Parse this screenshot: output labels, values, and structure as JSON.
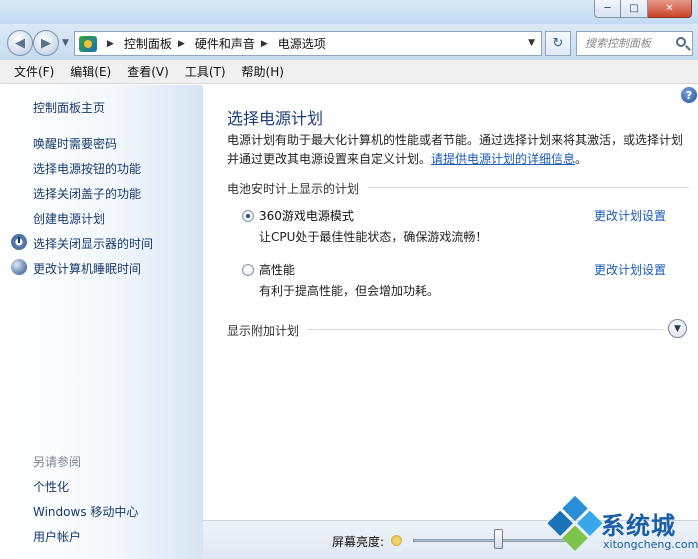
{
  "window": {
    "title": "",
    "minimize_glyph": "─",
    "maximize_glyph": "□",
    "close_glyph": "✕"
  },
  "navigation": {
    "back_glyph": "◀",
    "forward_glyph": "▶",
    "breadcrumbs": [
      "控制面板",
      "硬件和声音",
      "电源选项"
    ],
    "search_placeholder": "搜索控制面板"
  },
  "menu": [
    "文件(F)",
    "编辑(E)",
    "查看(V)",
    "工具(T)",
    "帮助(H)"
  ],
  "sidebar": {
    "home": "控制面板主页",
    "items": [
      {
        "label": "唤醒时需要密码",
        "icon": ""
      },
      {
        "label": "选择电源按钮的功能",
        "icon": ""
      },
      {
        "label": "选择关闭盖子的功能",
        "icon": ""
      },
      {
        "label": "创建电源计划",
        "icon": ""
      },
      {
        "label": "选择关闭显示器的时间",
        "icon": "clock-icon"
      },
      {
        "label": "更改计算机睡眠时间",
        "icon": "moon-icon"
      }
    ],
    "see_also_heading": "另请参阅",
    "see_also": [
      "个性化",
      "Windows 移动中心",
      "用户帐户"
    ]
  },
  "main": {
    "title": "选择电源计划",
    "intro_line1": "电源计划有助于最大化计算机的性能或者节能。通过选择计划来将其激活，或选择计划",
    "intro_line2": "并通过更改其电源设置来自定义计划。",
    "intro_link": "请提供电源计划的详细信息",
    "intro_end": "。",
    "section_battery": "电池安时计上显示的计划",
    "plans": [
      {
        "name": "360游戏电源模式",
        "description": "让CPU处于最佳性能状态，确保游戏流畅！",
        "change_link": "更改计划设置",
        "selected": true
      },
      {
        "name": "高性能",
        "description": "有利于提高性能，但会增加功耗。",
        "change_link": "更改计划设置",
        "selected": false
      }
    ],
    "section_additional": "显示附加计划"
  },
  "bottom": {
    "brightness_label": "屏幕亮度:",
    "brightness_fraction": 0.5
  },
  "watermark": {
    "text": "系统城",
    "domain": "xitongcheng.com"
  }
}
